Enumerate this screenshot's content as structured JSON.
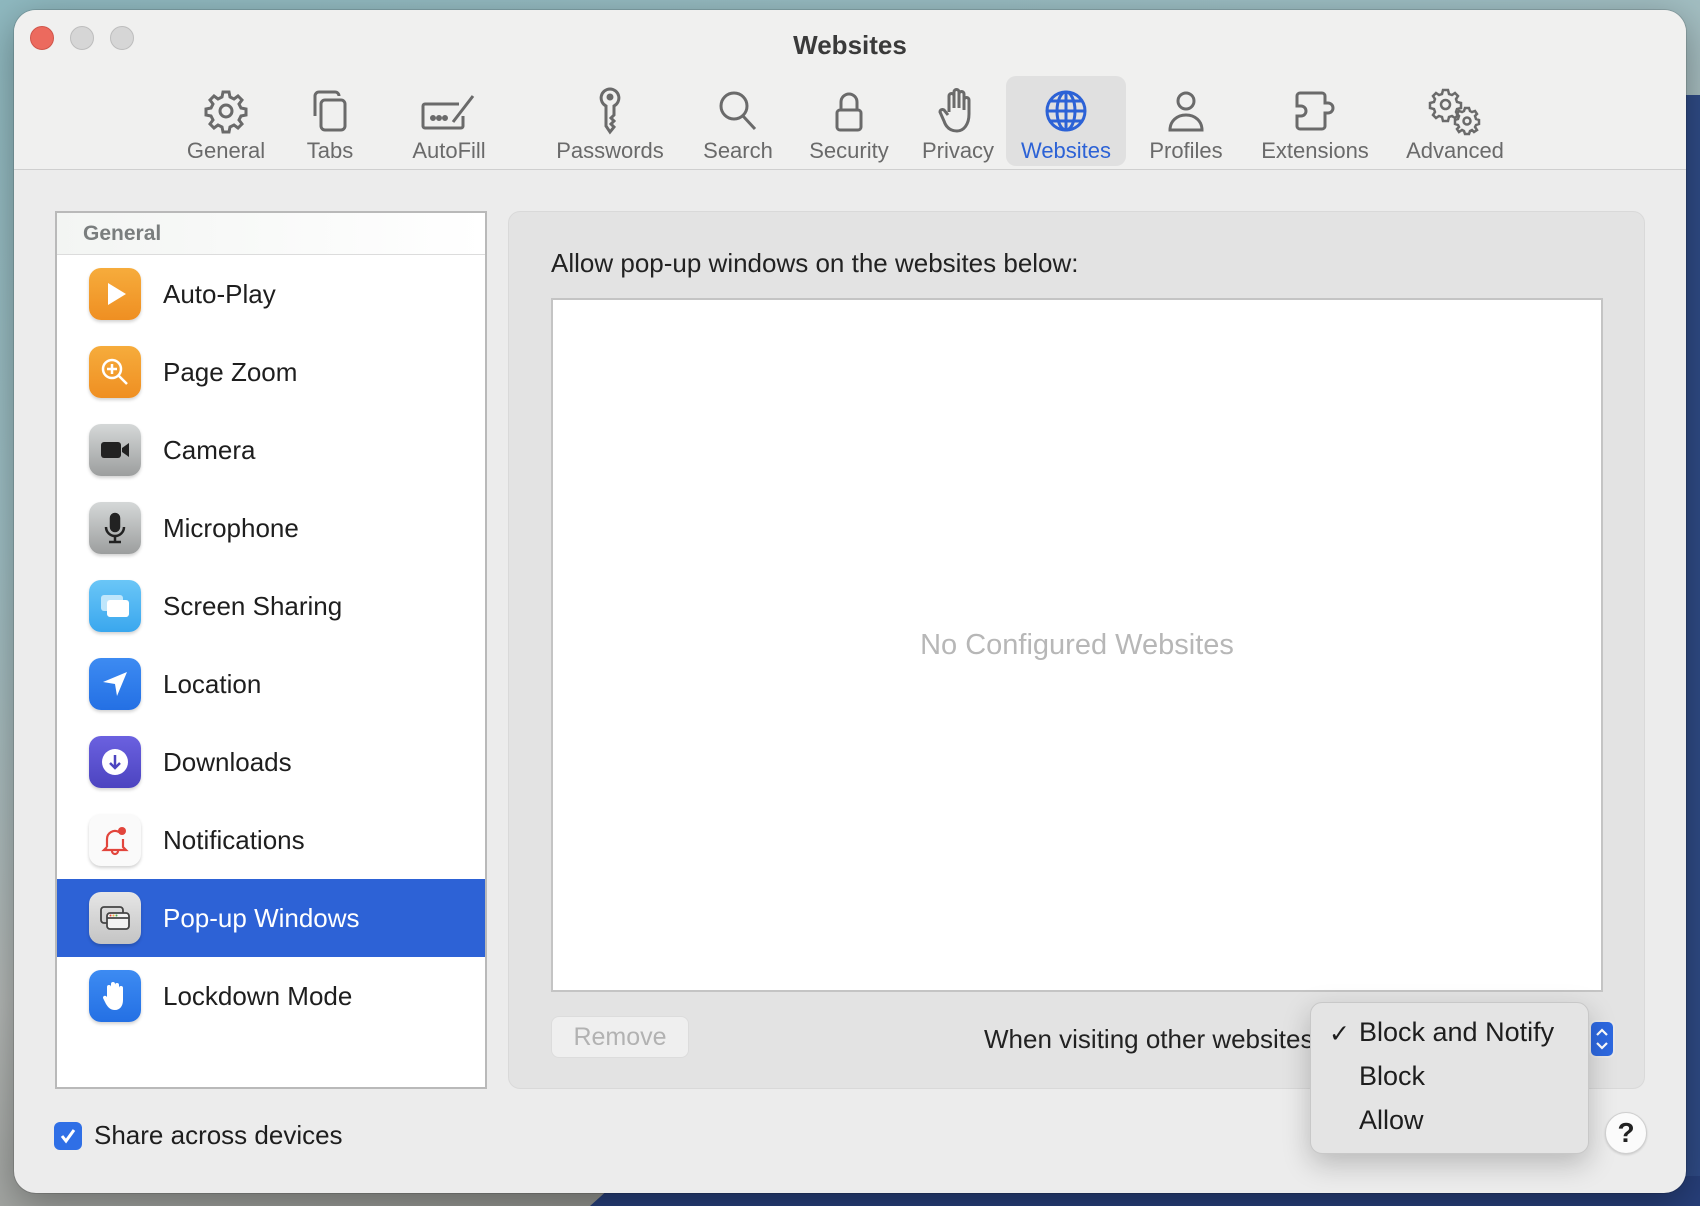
{
  "window": {
    "title": "Websites"
  },
  "toolbar": {
    "items": [
      {
        "label": "General",
        "icon": "gear-icon"
      },
      {
        "label": "Tabs",
        "icon": "tabs-icon"
      },
      {
        "label": "AutoFill",
        "icon": "autofill-icon"
      },
      {
        "label": "Passwords",
        "icon": "key-icon"
      },
      {
        "label": "Search",
        "icon": "search-icon"
      },
      {
        "label": "Security",
        "icon": "lock-icon"
      },
      {
        "label": "Privacy",
        "icon": "hand-icon"
      },
      {
        "label": "Websites",
        "icon": "globe-icon",
        "active": true
      },
      {
        "label": "Profiles",
        "icon": "person-icon"
      },
      {
        "label": "Extensions",
        "icon": "puzzle-icon"
      },
      {
        "label": "Advanced",
        "icon": "gears-icon"
      }
    ],
    "active_color": "#2c62d6"
  },
  "sidebar": {
    "section_header": "General",
    "items": [
      {
        "label": "Auto-Play",
        "icon": "play-icon"
      },
      {
        "label": "Page Zoom",
        "icon": "zoom-icon"
      },
      {
        "label": "Camera",
        "icon": "camera-icon"
      },
      {
        "label": "Microphone",
        "icon": "microphone-icon"
      },
      {
        "label": "Screen Sharing",
        "icon": "screen-sharing-icon"
      },
      {
        "label": "Location",
        "icon": "location-arrow-icon"
      },
      {
        "label": "Downloads",
        "icon": "download-icon"
      },
      {
        "label": "Notifications",
        "icon": "bell-icon"
      },
      {
        "label": "Pop-up Windows",
        "icon": "popup-windows-icon",
        "selected": true
      },
      {
        "label": "Lockdown Mode",
        "icon": "hand-raised-icon"
      }
    ],
    "selected_color": "#2d62d6"
  },
  "main": {
    "heading": "Allow pop-up windows on the websites below:",
    "empty_message": "No Configured Websites",
    "remove_button": "Remove",
    "other_websites_label": "When visiting other websites:",
    "other_websites_menu": {
      "options": [
        "Block and Notify",
        "Block",
        "Allow"
      ],
      "selected": "Block and Notify",
      "check_glyph": "✓"
    }
  },
  "footer": {
    "share_label": "Share across devices",
    "share_checked": true,
    "help_label": "?"
  }
}
